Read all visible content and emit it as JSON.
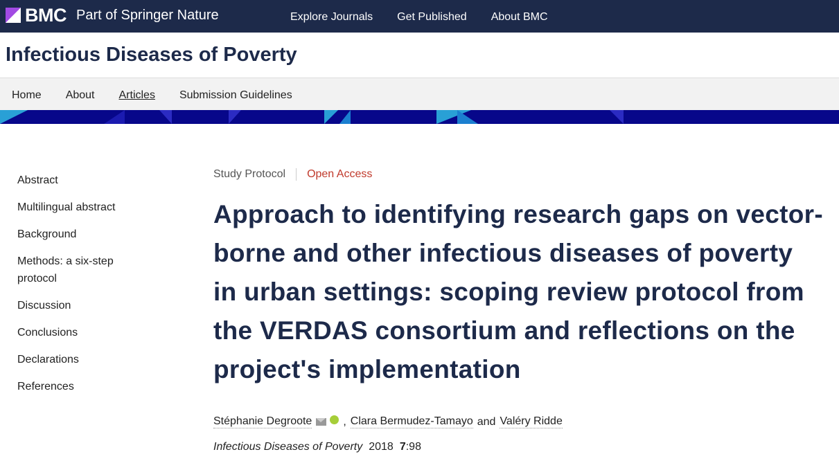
{
  "topbar": {
    "brand": "BMC",
    "tagline": "Part of Springer Nature",
    "nav": [
      "Explore Journals",
      "Get Published",
      "About BMC"
    ]
  },
  "journal": {
    "title": "Infectious Diseases of Poverty",
    "nav": [
      "Home",
      "About",
      "Articles",
      "Submission Guidelines"
    ],
    "active_nav": "Articles"
  },
  "sidebar": {
    "items": [
      "Abstract",
      "Multilingual abstract",
      "Background",
      "Methods: a six-step protocol",
      "Discussion",
      "Conclusions",
      "Declarations",
      "References"
    ]
  },
  "article": {
    "type": "Study Protocol",
    "access": "Open Access",
    "title": "Approach to identifying research gaps on vector-borne and other infectious diseases of poverty in urban settings: scoping review protocol from the VERDAS consortium and reflections on the project's implementation",
    "authors": [
      {
        "name": "Stéphanie Degroote"
      },
      {
        "name": "Clara Bermudez-Tamayo"
      },
      {
        "name": "Valéry Ridde"
      }
    ],
    "author_separator": ",",
    "author_and": "and",
    "citation": {
      "journal": "Infectious Diseases of Poverty",
      "year": "2018",
      "volume": "7",
      "article": ":98"
    }
  },
  "colors": {
    "topbar_bg": "#1d2a4a",
    "banner_bg": "#07078a",
    "open_access": "#c0392b",
    "title": "#1d2a4a"
  }
}
